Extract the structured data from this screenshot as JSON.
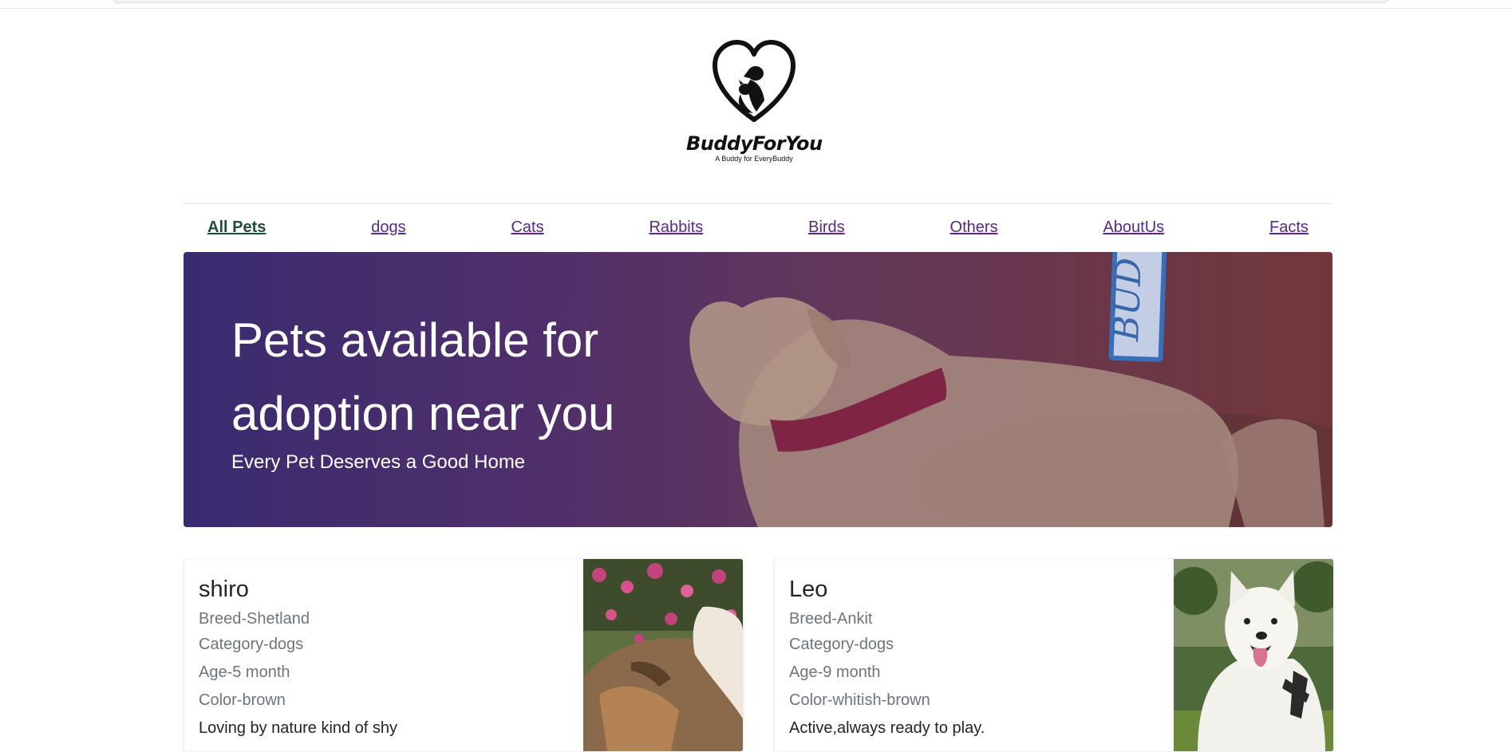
{
  "brand": {
    "name": "BuddyForYou",
    "tagline": "A Buddy for EveryBuddy"
  },
  "nav": {
    "items": [
      "All Pets",
      "dogs",
      "Cats",
      "Rabbits",
      "Birds",
      "Others",
      "AboutUs",
      "Facts"
    ],
    "active": "All Pets"
  },
  "hero": {
    "title": "Pets available for adoption near you",
    "subtitle": "Every Pet Deserves a Good Home",
    "sign_text": "BUD"
  },
  "pets": [
    {
      "name": "shiro",
      "breed": "Breed-Shetland",
      "category": "Category-dogs",
      "age": "Age-5 month",
      "color": "Color-brown",
      "description": "Loving by nature kind of shy"
    },
    {
      "name": "Leo",
      "breed": "Breed-Ankit",
      "category": "Category-dogs",
      "age": "Age-9 month",
      "color": "Color-whitish-brown",
      "description": "Active,always ready to play."
    }
  ],
  "colors": {
    "nav_link": "#5a2a82",
    "nav_active": "#1f4d3a",
    "hero_left": "#3a2c70",
    "hero_right": "#7a3a32"
  }
}
